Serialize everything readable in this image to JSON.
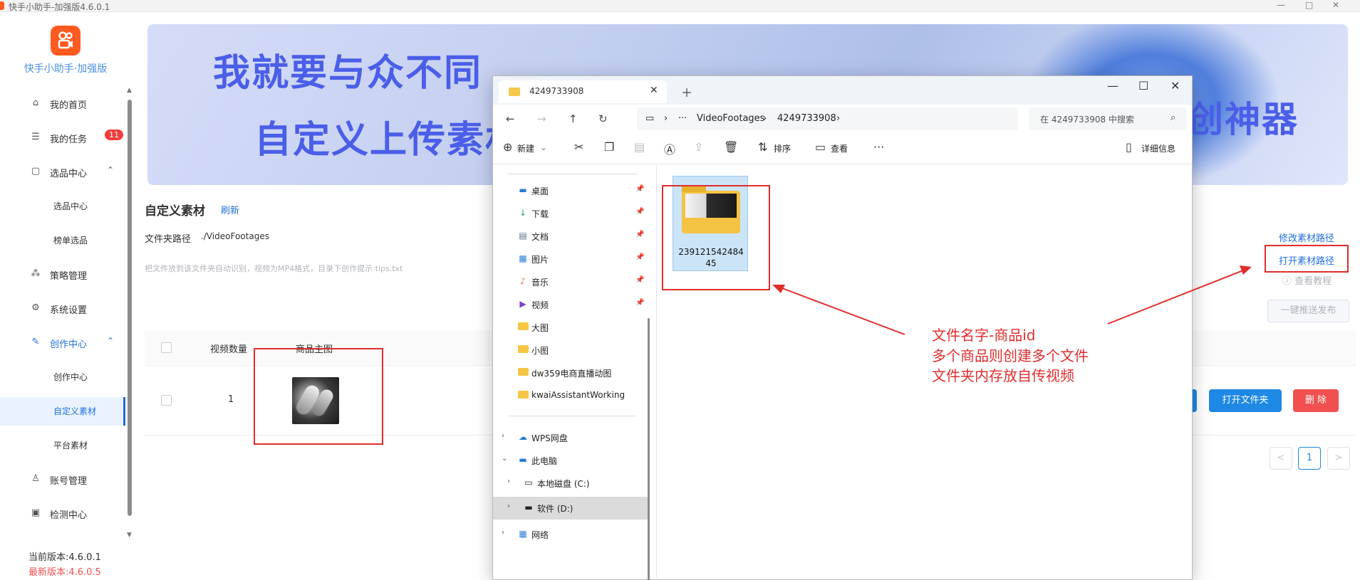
{
  "app": {
    "title": "快手小助手-加强版4.6.0.1",
    "brand": "快手小助手·加强版"
  },
  "sidebar": {
    "items": [
      {
        "label": "我的首页",
        "icon": "home-icon"
      },
      {
        "label": "我的任务",
        "icon": "task-list-icon",
        "badge": "11"
      },
      {
        "label": "选品中心",
        "icon": "bag-icon",
        "expanded": true
      },
      {
        "label": "选品中心",
        "sub": true
      },
      {
        "label": "榜单选品",
        "sub": true
      },
      {
        "label": "策略管理",
        "icon": "strategy-icon"
      },
      {
        "label": "系统设置",
        "icon": "gear-icon"
      },
      {
        "label": "创作中心",
        "icon": "edit-icon",
        "expanded": true
      },
      {
        "label": "创作中心",
        "sub": true
      },
      {
        "label": "自定义素材",
        "sub": true,
        "active": true
      },
      {
        "label": "平台素材",
        "sub": true
      },
      {
        "label": "账号管理",
        "icon": "user-icon"
      },
      {
        "label": "检测中心",
        "icon": "monitor-icon"
      }
    ],
    "current_version": "当前版本:4.6.0.1",
    "latest_version": "最新版本:4.6.0.5"
  },
  "banner": {
    "line1": "我就要与众不同",
    "line2": "自定义上传素材",
    "line3": "创神器"
  },
  "main": {
    "title": "自定义素材",
    "refresh": "刷新",
    "path_label": "文件夹路径",
    "path_value": "./VideoFootages",
    "hint": "把文件放到该文件夹自动识别，视频为MP4格式，目录下创作提示 tips.txt",
    "modify_path": "修改素材路径",
    "open_path": "打开素材路径",
    "tutorial": "查看教程",
    "push_all": "一键推送发布",
    "table": {
      "headers": [
        "视频数量",
        "商品主图"
      ],
      "rows": [
        {
          "count": "1"
        }
      ]
    },
    "open_folder": "打开文件夹",
    "delete": "删 除",
    "pagination": {
      "prev": "<",
      "current": "1",
      "next": ">"
    }
  },
  "explorer": {
    "tab_title": "4249733908",
    "breadcrumb": [
      "VideoFootages",
      "4249733908"
    ],
    "search_placeholder": "在 4249733908 中搜索",
    "toolbar": {
      "new": "新建",
      "sort": "排序",
      "view": "查看",
      "details": "详细信息"
    },
    "quick_access": [
      {
        "label": "桌面",
        "icon": "desktop-icon"
      },
      {
        "label": "下载",
        "icon": "download-icon"
      },
      {
        "label": "文档",
        "icon": "document-icon"
      },
      {
        "label": "图片",
        "icon": "picture-icon"
      },
      {
        "label": "音乐",
        "icon": "music-icon"
      },
      {
        "label": "视频",
        "icon": "video-icon"
      },
      {
        "label": "大图",
        "icon": "folder-icon"
      },
      {
        "label": "小图",
        "icon": "folder-icon"
      },
      {
        "label": "dw359电商直播动图",
        "icon": "folder-icon"
      },
      {
        "label": "kwaiAssistantWorking",
        "icon": "folder-icon"
      }
    ],
    "tree": [
      {
        "label": "WPS网盘",
        "icon": "cloud-icon"
      },
      {
        "label": "此电脑",
        "icon": "computer-icon"
      },
      {
        "label": "本地磁盘 (C:)",
        "icon": "drive-icon"
      },
      {
        "label": "软件 (D:)",
        "icon": "drive-icon",
        "selected": true
      },
      {
        "label": "网络",
        "icon": "network-icon"
      }
    ],
    "folder_name": "23912154248445"
  },
  "annotation": {
    "line1": "文件名字-商品id",
    "line2": "多个商品则创建多个文件",
    "line3": "文件夹内存放自传视频"
  },
  "colors": {
    "accent": "#1e88e5",
    "danger": "#f0504f",
    "annotation": "#e02d2d",
    "brand_orange": "#ff5a1f"
  }
}
